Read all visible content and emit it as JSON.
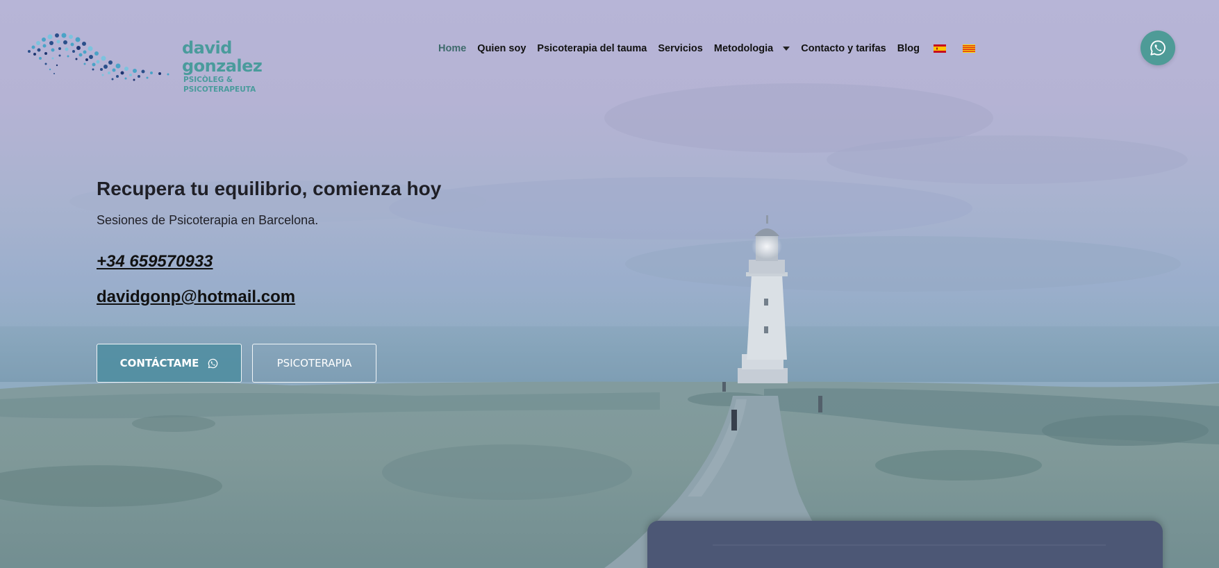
{
  "brand": {
    "name": "david gonzalez",
    "tagline": "PSICÒLEG & PSICOTERAPEUTA",
    "logo_colors": [
      "#2b4f8a",
      "#4aa3c7",
      "#7cc3de",
      "#1e3570"
    ]
  },
  "nav": {
    "items": [
      {
        "label": "Home",
        "active": true
      },
      {
        "label": "Quien soy",
        "active": false
      },
      {
        "label": "Psicoterapia del tauma",
        "active": false
      },
      {
        "label": "Servicios",
        "active": false
      },
      {
        "label": "Metodologia",
        "active": false,
        "has_dropdown": true
      },
      {
        "label": "Contacto y tarifas",
        "active": false
      },
      {
        "label": "Blog",
        "active": false
      }
    ],
    "languages": [
      {
        "icon": "spain-flag-icon"
      },
      {
        "icon": "catalonia-flag-icon"
      }
    ]
  },
  "whatsapp": {
    "icon": "whatsapp-icon",
    "color": "#4e9b97"
  },
  "hero": {
    "title": "Recupera tu equilibrio, comienza hoy",
    "subtitle": "Sesiones de Psicoterapia en Barcelona.",
    "phone": "+34 659570933",
    "email": "davidgonp@hotmail.com",
    "buttons": {
      "contact_label": "CONTÁCTAME",
      "psychotherapy_label": "PSICOTERAPIA"
    }
  },
  "colors": {
    "accent": "#4a9b9c",
    "button_fill": "#4e8da0",
    "card": "#4c5775"
  }
}
